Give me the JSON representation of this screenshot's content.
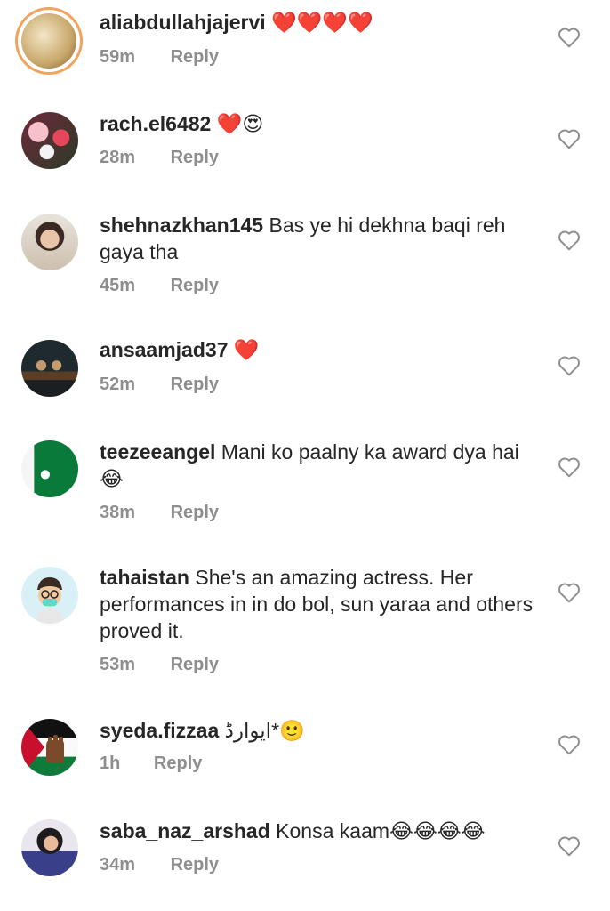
{
  "comments": [
    {
      "username": "aliabdullahjajervi",
      "text": "",
      "emoji": "❤️❤️❤️❤️",
      "time": "59m",
      "reply": "Reply"
    },
    {
      "username": "rach.el6482",
      "text": "",
      "emoji": "❤️😍",
      "time": "28m",
      "reply": "Reply"
    },
    {
      "username": "shehnazkhan145",
      "text": "Bas ye hi dekhna baqi reh gaya tha",
      "emoji": "",
      "time": "45m",
      "reply": "Reply"
    },
    {
      "username": "ansaamjad37",
      "text": "",
      "emoji": "❤️",
      "time": "52m",
      "reply": "Reply"
    },
    {
      "username": "teezeeangel",
      "text": "Mani ko paalny ka award dya hai",
      "emoji": "😂",
      "time": "38m",
      "reply": "Reply"
    },
    {
      "username": "tahaistan",
      "text": "She's an amazing actress. Her performances in in do bol, sun yaraa and others proved it.",
      "emoji": "",
      "time": "53m",
      "reply": "Reply"
    },
    {
      "username": "syeda.fizzaa",
      "text": "ایوارڈ*",
      "emoji": "🙂",
      "time": "1h",
      "reply": "Reply"
    },
    {
      "username": "saba_naz_arshad",
      "text": "Konsa kaam",
      "emoji": "😂😂😂😂",
      "time": "34m",
      "reply": "Reply"
    }
  ],
  "icons": {
    "like": "heart-outline-icon"
  },
  "colors": {
    "text": "#262626",
    "meta": "#8e8e8e",
    "like_heart": "#e0245e",
    "story_ring": "#f2a35e"
  }
}
